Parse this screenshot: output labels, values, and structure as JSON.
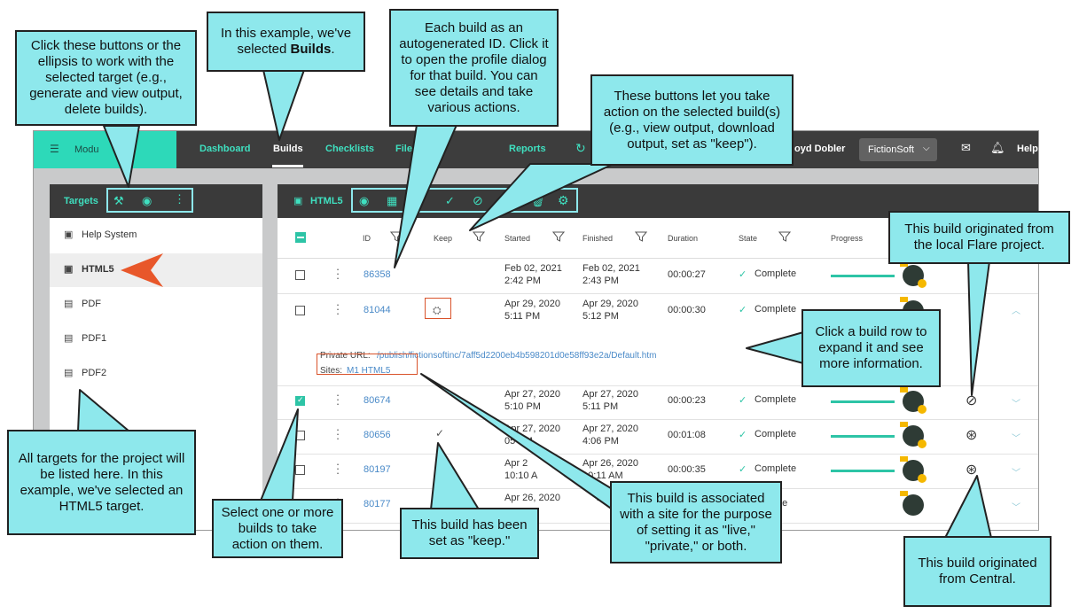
{
  "app": {
    "menu_label": "Modu",
    "nav": [
      "Dashboard",
      "Builds",
      "Checklists",
      "Files",
      "Reports"
    ],
    "user": "oyd Dobler",
    "project": "FictionSoft",
    "help": "Help"
  },
  "targets_panel": {
    "title": "Targets",
    "items": [
      "Help System",
      "HTML5",
      "PDF",
      "PDF1",
      "PDF2"
    ]
  },
  "builds_panel": {
    "title": "HTML5",
    "columns": [
      "ID",
      "Keep",
      "Started",
      "Finished",
      "Duration",
      "State",
      "Progress"
    ],
    "rows": [
      {
        "id": "86358",
        "started_date": "Feb 02, 2021",
        "started_time": "2:42 PM",
        "finished_date": "Feb 02, 2021",
        "finished_time": "2:43 PM",
        "duration": "00:00:27",
        "state": "Complete"
      },
      {
        "id": "81044",
        "started_date": "Apr 29, 2020",
        "started_time": "5:11 PM",
        "finished_date": "Apr 29, 2020",
        "finished_time": "5:12 PM",
        "duration": "00:00:30",
        "state": "Complete"
      },
      {
        "id": "80674",
        "started_date": "Apr 27, 2020",
        "started_time": "5:10 PM",
        "finished_date": "Apr 27, 2020",
        "finished_time": "5:11 PM",
        "duration": "00:00:23",
        "state": "Complete"
      },
      {
        "id": "80656",
        "started_date": "Apr 27, 2020",
        "started_time": "05 PM",
        "finished_date": "Apr 27, 2020",
        "finished_time": "4:06 PM",
        "duration": "00:01:08",
        "state": "Complete"
      },
      {
        "id": "80197",
        "started_date": "Apr 2",
        "started_time": "10:10 A",
        "finished_date": "Apr 26, 2020",
        "finished_time": "10:11 AM",
        "duration": "00:00:35",
        "state": "Complete"
      },
      {
        "id": "80177",
        "started_date": "Apr 26, 2020",
        "started_time": "",
        "finished_date": "26",
        "finished_time": "",
        "duration": "",
        "state": "ete"
      }
    ],
    "expanded": {
      "private_url_label": "Private URL:",
      "private_url": "/publish/fictionsoftinc/7aff5d2200eb4b598201d0e58ff93e2a/Default.htm",
      "sites_label": "Sites:",
      "sites_value": "M1 HTML5"
    }
  },
  "callouts": {
    "buttons": "Click these buttons or the ellipsis to work with the selected target (e.g., generate and view output, delete builds).",
    "builds_pre": "In this example, we've selected",
    "builds_bold": "Builds",
    "builds_post": ".",
    "id": "Each build as an autogenerated ID. Click it to open the profile dialog for that build. You can see details and take various actions.",
    "actions": "These buttons let you take action on the selected build(s) (e.g., view output, download output, set as \"keep\").",
    "local": "This build originated from the local Flare project.",
    "expand": "Click a build row to expand it and see more information.",
    "targets": "All targets for the project will be listed here. In this example, we've selected an HTML5 target.",
    "select": "Select one or more builds to take action on them.",
    "keep": "This build has been set as \"keep.\"",
    "site": "This build is associated with a site for the purpose of setting it as \"live,\" \"private,\" or both.",
    "central": "This build originated from Central."
  },
  "colors": {
    "accent": "#2dd9b9",
    "callout": "#8ee8ec",
    "link": "#4a8ac8",
    "arrow": "#e8572a"
  }
}
